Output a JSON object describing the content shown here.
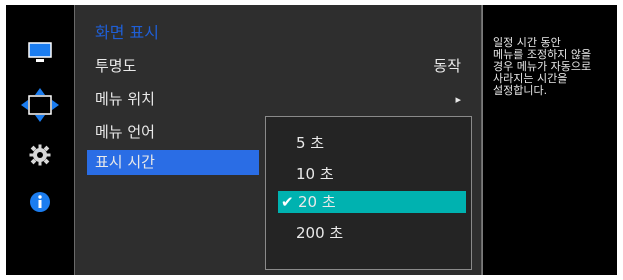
{
  "icons": [
    {
      "name": "display-icon"
    },
    {
      "name": "move-arrows-icon"
    },
    {
      "name": "gear-icon"
    },
    {
      "name": "info-icon"
    }
  ],
  "menu": {
    "title": "화면 표시",
    "items": [
      {
        "label": "투명도",
        "value": "동작"
      },
      {
        "label": "메뉴 위치",
        "value": "▸"
      },
      {
        "label": "메뉴 언어",
        "value": ""
      },
      {
        "label": "표시 시간",
        "value": ""
      }
    ]
  },
  "submenu": {
    "options": [
      {
        "label": "5 초"
      },
      {
        "label": "10 초"
      },
      {
        "label": "20 초",
        "check": "✔"
      },
      {
        "label": "200 초"
      }
    ]
  },
  "help": {
    "text": "일정 시간 동안\n메뉴를 조정하지 않을\n경우 메뉴가 자동으로\n사라지는 시간을\n설정합니다."
  },
  "colors": {
    "highlight_blue": "#2a6de5",
    "title_blue": "#1f5fd6",
    "selected_teal": "#00b2b0"
  }
}
